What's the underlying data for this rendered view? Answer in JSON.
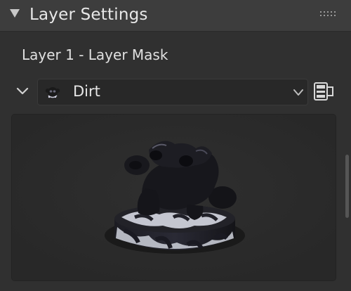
{
  "panel": {
    "title": "Layer Settings",
    "collapse_icon": "disclosure-triangle-down-icon",
    "drag_icon": "drag-grip-icon"
  },
  "layer": {
    "mask_label": "Layer 1 - Layer Mask",
    "texture": {
      "selected": "Dirt",
      "thumbnail_icon": "monkey-thumbnail-icon",
      "dropdown_icon": "chevron-down-icon",
      "browse_icon": "film-browse-icon"
    },
    "expand_icon": "chevron-down-icon",
    "preview_icon": "monkey-preview-render"
  },
  "colors": {
    "header_bg": "#3d3d3d",
    "panel_bg": "#303030",
    "field_bg": "#282828",
    "preview_bg": "#2b2b2b"
  }
}
